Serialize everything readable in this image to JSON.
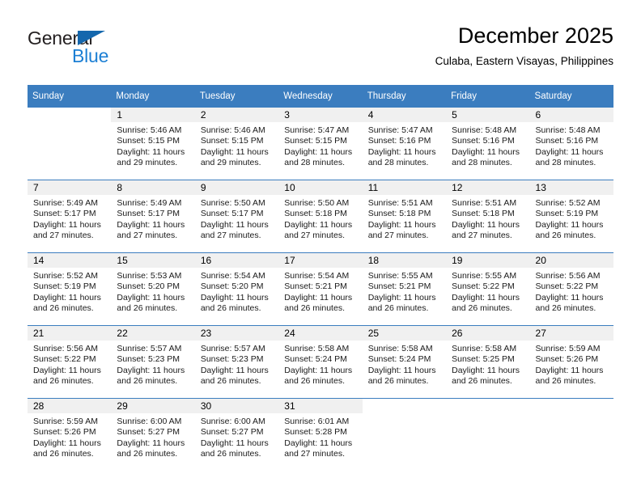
{
  "brand": {
    "name_part1": "General",
    "name_part2": "Blue",
    "triangle_icon": "triangle-icon",
    "accent_dark": "#1467ad",
    "accent_light": "#1c7fd4"
  },
  "header": {
    "title": "December 2025",
    "subtitle": "Culaba, Eastern Visayas, Philippines"
  },
  "theme": {
    "header_background": "#3b7dbf",
    "header_text": "#ffffff",
    "daynum_background": "#f0f0f0",
    "cell_background": "#ffffff",
    "grid_line": "#3b7dbf"
  },
  "calendar": {
    "weekday_headers": [
      "Sunday",
      "Monday",
      "Tuesday",
      "Wednesday",
      "Thursday",
      "Friday",
      "Saturday"
    ],
    "weeks": [
      [
        {
          "day": "",
          "sunrise": "",
          "sunset": "",
          "daylight_line1": "",
          "daylight_line2": "",
          "empty": true
        },
        {
          "day": "1",
          "sunrise": "Sunrise: 5:46 AM",
          "sunset": "Sunset: 5:15 PM",
          "daylight_line1": "Daylight: 11 hours",
          "daylight_line2": "and 29 minutes."
        },
        {
          "day": "2",
          "sunrise": "Sunrise: 5:46 AM",
          "sunset": "Sunset: 5:15 PM",
          "daylight_line1": "Daylight: 11 hours",
          "daylight_line2": "and 29 minutes."
        },
        {
          "day": "3",
          "sunrise": "Sunrise: 5:47 AM",
          "sunset": "Sunset: 5:15 PM",
          "daylight_line1": "Daylight: 11 hours",
          "daylight_line2": "and 28 minutes."
        },
        {
          "day": "4",
          "sunrise": "Sunrise: 5:47 AM",
          "sunset": "Sunset: 5:16 PM",
          "daylight_line1": "Daylight: 11 hours",
          "daylight_line2": "and 28 minutes."
        },
        {
          "day": "5",
          "sunrise": "Sunrise: 5:48 AM",
          "sunset": "Sunset: 5:16 PM",
          "daylight_line1": "Daylight: 11 hours",
          "daylight_line2": "and 28 minutes."
        },
        {
          "day": "6",
          "sunrise": "Sunrise: 5:48 AM",
          "sunset": "Sunset: 5:16 PM",
          "daylight_line1": "Daylight: 11 hours",
          "daylight_line2": "and 28 minutes."
        }
      ],
      [
        {
          "day": "7",
          "sunrise": "Sunrise: 5:49 AM",
          "sunset": "Sunset: 5:17 PM",
          "daylight_line1": "Daylight: 11 hours",
          "daylight_line2": "and 27 minutes."
        },
        {
          "day": "8",
          "sunrise": "Sunrise: 5:49 AM",
          "sunset": "Sunset: 5:17 PM",
          "daylight_line1": "Daylight: 11 hours",
          "daylight_line2": "and 27 minutes."
        },
        {
          "day": "9",
          "sunrise": "Sunrise: 5:50 AM",
          "sunset": "Sunset: 5:17 PM",
          "daylight_line1": "Daylight: 11 hours",
          "daylight_line2": "and 27 minutes."
        },
        {
          "day": "10",
          "sunrise": "Sunrise: 5:50 AM",
          "sunset": "Sunset: 5:18 PM",
          "daylight_line1": "Daylight: 11 hours",
          "daylight_line2": "and 27 minutes."
        },
        {
          "day": "11",
          "sunrise": "Sunrise: 5:51 AM",
          "sunset": "Sunset: 5:18 PM",
          "daylight_line1": "Daylight: 11 hours",
          "daylight_line2": "and 27 minutes."
        },
        {
          "day": "12",
          "sunrise": "Sunrise: 5:51 AM",
          "sunset": "Sunset: 5:18 PM",
          "daylight_line1": "Daylight: 11 hours",
          "daylight_line2": "and 27 minutes."
        },
        {
          "day": "13",
          "sunrise": "Sunrise: 5:52 AM",
          "sunset": "Sunset: 5:19 PM",
          "daylight_line1": "Daylight: 11 hours",
          "daylight_line2": "and 26 minutes."
        }
      ],
      [
        {
          "day": "14",
          "sunrise": "Sunrise: 5:52 AM",
          "sunset": "Sunset: 5:19 PM",
          "daylight_line1": "Daylight: 11 hours",
          "daylight_line2": "and 26 minutes."
        },
        {
          "day": "15",
          "sunrise": "Sunrise: 5:53 AM",
          "sunset": "Sunset: 5:20 PM",
          "daylight_line1": "Daylight: 11 hours",
          "daylight_line2": "and 26 minutes."
        },
        {
          "day": "16",
          "sunrise": "Sunrise: 5:54 AM",
          "sunset": "Sunset: 5:20 PM",
          "daylight_line1": "Daylight: 11 hours",
          "daylight_line2": "and 26 minutes."
        },
        {
          "day": "17",
          "sunrise": "Sunrise: 5:54 AM",
          "sunset": "Sunset: 5:21 PM",
          "daylight_line1": "Daylight: 11 hours",
          "daylight_line2": "and 26 minutes."
        },
        {
          "day": "18",
          "sunrise": "Sunrise: 5:55 AM",
          "sunset": "Sunset: 5:21 PM",
          "daylight_line1": "Daylight: 11 hours",
          "daylight_line2": "and 26 minutes."
        },
        {
          "day": "19",
          "sunrise": "Sunrise: 5:55 AM",
          "sunset": "Sunset: 5:22 PM",
          "daylight_line1": "Daylight: 11 hours",
          "daylight_line2": "and 26 minutes."
        },
        {
          "day": "20",
          "sunrise": "Sunrise: 5:56 AM",
          "sunset": "Sunset: 5:22 PM",
          "daylight_line1": "Daylight: 11 hours",
          "daylight_line2": "and 26 minutes."
        }
      ],
      [
        {
          "day": "21",
          "sunrise": "Sunrise: 5:56 AM",
          "sunset": "Sunset: 5:22 PM",
          "daylight_line1": "Daylight: 11 hours",
          "daylight_line2": "and 26 minutes."
        },
        {
          "day": "22",
          "sunrise": "Sunrise: 5:57 AM",
          "sunset": "Sunset: 5:23 PM",
          "daylight_line1": "Daylight: 11 hours",
          "daylight_line2": "and 26 minutes."
        },
        {
          "day": "23",
          "sunrise": "Sunrise: 5:57 AM",
          "sunset": "Sunset: 5:23 PM",
          "daylight_line1": "Daylight: 11 hours",
          "daylight_line2": "and 26 minutes."
        },
        {
          "day": "24",
          "sunrise": "Sunrise: 5:58 AM",
          "sunset": "Sunset: 5:24 PM",
          "daylight_line1": "Daylight: 11 hours",
          "daylight_line2": "and 26 minutes."
        },
        {
          "day": "25",
          "sunrise": "Sunrise: 5:58 AM",
          "sunset": "Sunset: 5:24 PM",
          "daylight_line1": "Daylight: 11 hours",
          "daylight_line2": "and 26 minutes."
        },
        {
          "day": "26",
          "sunrise": "Sunrise: 5:58 AM",
          "sunset": "Sunset: 5:25 PM",
          "daylight_line1": "Daylight: 11 hours",
          "daylight_line2": "and 26 minutes."
        },
        {
          "day": "27",
          "sunrise": "Sunrise: 5:59 AM",
          "sunset": "Sunset: 5:26 PM",
          "daylight_line1": "Daylight: 11 hours",
          "daylight_line2": "and 26 minutes."
        }
      ],
      [
        {
          "day": "28",
          "sunrise": "Sunrise: 5:59 AM",
          "sunset": "Sunset: 5:26 PM",
          "daylight_line1": "Daylight: 11 hours",
          "daylight_line2": "and 26 minutes."
        },
        {
          "day": "29",
          "sunrise": "Sunrise: 6:00 AM",
          "sunset": "Sunset: 5:27 PM",
          "daylight_line1": "Daylight: 11 hours",
          "daylight_line2": "and 26 minutes."
        },
        {
          "day": "30",
          "sunrise": "Sunrise: 6:00 AM",
          "sunset": "Sunset: 5:27 PM",
          "daylight_line1": "Daylight: 11 hours",
          "daylight_line2": "and 26 minutes."
        },
        {
          "day": "31",
          "sunrise": "Sunrise: 6:01 AM",
          "sunset": "Sunset: 5:28 PM",
          "daylight_line1": "Daylight: 11 hours",
          "daylight_line2": "and 27 minutes."
        },
        {
          "day": "",
          "sunrise": "",
          "sunset": "",
          "daylight_line1": "",
          "daylight_line2": "",
          "empty": true
        },
        {
          "day": "",
          "sunrise": "",
          "sunset": "",
          "daylight_line1": "",
          "daylight_line2": "",
          "empty": true
        },
        {
          "day": "",
          "sunrise": "",
          "sunset": "",
          "daylight_line1": "",
          "daylight_line2": "",
          "empty": true
        }
      ]
    ]
  }
}
